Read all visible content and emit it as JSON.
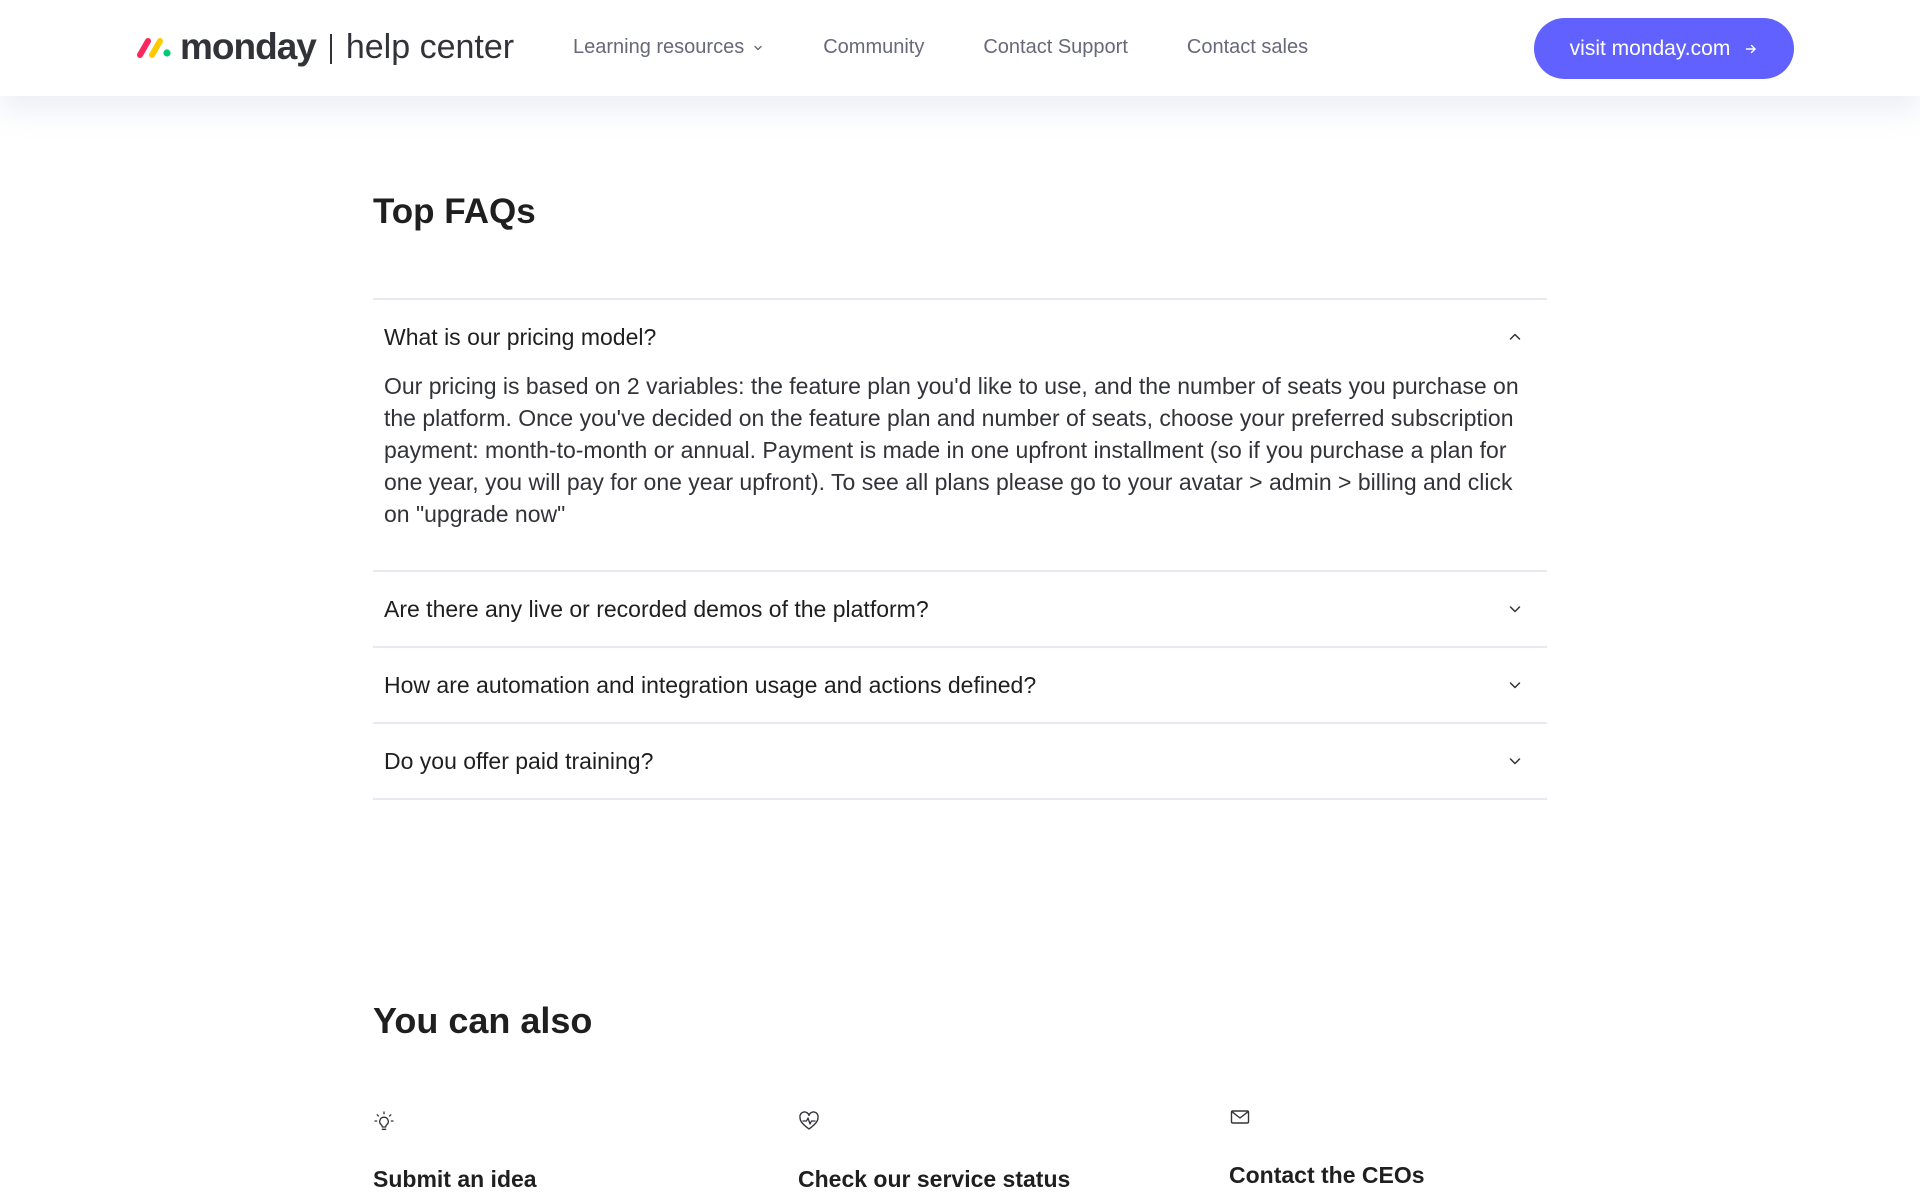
{
  "header": {
    "logo_word": "monday",
    "logo_sub": "help center",
    "nav": [
      {
        "label": "Learning resources",
        "has_dropdown": true
      },
      {
        "label": "Community"
      },
      {
        "label": "Contact Support"
      },
      {
        "label": "Contact sales"
      }
    ],
    "cta_label": "visit monday.com",
    "colors": {
      "cta": "#6161ff",
      "logo_red": "#fb275d",
      "logo_yellow": "#ffcb00",
      "logo_green": "#00ca72"
    }
  },
  "faq": {
    "title": "Top FAQs",
    "items": [
      {
        "question": "What is our pricing model?",
        "expanded": true,
        "answer": "Our pricing is based on 2 variables: the feature plan you'd like to use, and the number of seats you purchase on the platform. Once you've decided on the feature plan and number of seats, choose your preferred subscription payment: month-to-month or annual. Payment is made in one upfront installment (so if you purchase a plan for one year, you will pay for one year upfront). To see all plans please go to your avatar > admin > billing and click on \"upgrade now\""
      },
      {
        "question": "Are there any live or recorded demos of the platform?",
        "expanded": false
      },
      {
        "question": "How are automation and integration usage and actions defined?",
        "expanded": false
      },
      {
        "question": "Do you offer paid training?",
        "expanded": false
      }
    ]
  },
  "also": {
    "title": "You can also",
    "cards": [
      {
        "icon": "lightbulb-icon",
        "title": "Submit an idea"
      },
      {
        "icon": "heart-pulse-icon",
        "title": "Check our service status"
      },
      {
        "icon": "envelope-icon",
        "title": "Contact the CEOs"
      }
    ]
  }
}
